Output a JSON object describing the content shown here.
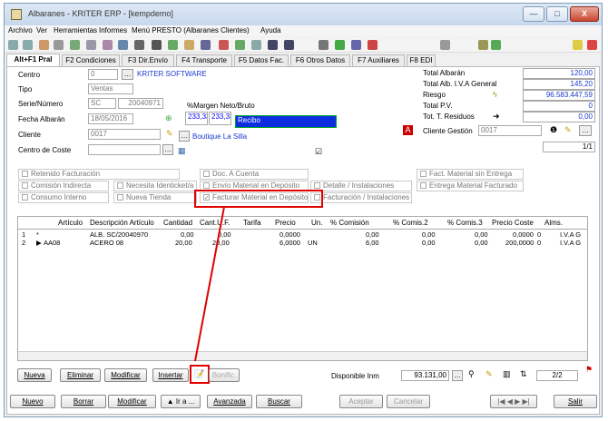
{
  "window": {
    "title": "Albaranes - KRITER ERP - [kempdemo]",
    "min": "—",
    "max": "□",
    "close": "X"
  },
  "menu": [
    "Archivo",
    "Ver",
    "Herramientas",
    "Informes",
    "Menú PRESTO (Albaranes Clientes)",
    "Ayuda"
  ],
  "tabs": [
    "Alt+F1 Pral",
    "F2 Condiciones",
    "F3 Dir.Envío",
    "F4 Transporte",
    "F5 Datos Fac.",
    "F6 Otros Datos",
    "F7 Auxiliares",
    "F8 EDI"
  ],
  "form": {
    "centro_label": "Centro",
    "centro_value": "0",
    "centro_name": "KRITER SOFTWARE",
    "tipo_label": "Tipo",
    "tipo_value": "Ventas",
    "serie_label": "Serie/Número",
    "serie_value": "SC",
    "numero_value": "20040971",
    "fecha_label": "Fecha Albarán",
    "fecha_value": "18/05/2016",
    "cliente_label": "Cliente",
    "cliente_value": "0017",
    "cliente_name": "Boutique La Silla",
    "centro_coste_label": "Centro de Coste",
    "margen_label": "%Margen Neto/Bruto",
    "margen_neto": "233,33",
    "margen_bruto": "233,33",
    "recibo": "Recibo"
  },
  "totals": {
    "total_albaran_label": "Total Albarán",
    "total_albaran": "120,00",
    "total_iva_label": "Total Alb. I.V.A General",
    "total_iva": "145,20",
    "riesgo_label": "Riesgo",
    "riesgo": "96.583.447,59",
    "total_pv_label": "Total P.V.",
    "total_pv": "0",
    "residuos_label": "Tot. T. Residuos",
    "residuos": "0,00",
    "cliente_gestion_label": "Cliente Gestión",
    "cliente_gestion": "0017",
    "page": "1/1"
  },
  "checks": {
    "retenido": "Retenido Facturación",
    "doc_cuenta": "Doc. A Cuenta",
    "fact_sin_entrega": "Fact. Material sin Entrega",
    "comision_indirecta": "Comisión Indirecta",
    "necesita_ident": "Necesita Identicket/a",
    "envio_deposito": "Envío Material en Depósito",
    "detalle_instal": "Detalle / Instalaciones",
    "entrega_facturado": "Entrega Material Facturado",
    "consumo_interno": "Consumo Interno",
    "nueva_tienda": "Nueva Tienda",
    "facturar_deposito": "Facturar Material en Depósito",
    "facturacion_instal": "Facturación / Instalaciones"
  },
  "grid": {
    "headers": [
      "Artículo",
      "Descripción Artículo",
      "Cantidad",
      "Cant.U.F.",
      "Tarifa",
      "Precio",
      "Un.",
      "% Comisión",
      "% Comis.2",
      "% Comis.3",
      "Precio Coste",
      "Alms."
    ],
    "rows": [
      {
        "n": "1",
        "mark": "*",
        "articulo": "",
        "desc": "ALB. SC/20040970",
        "cantidad": "0,00",
        "cantuf": "0,00",
        "tarifa": "",
        "precio": "0,0000",
        "un": "",
        "com": "0,00",
        "com2": "0,00",
        "com3": "0,00",
        "coste": "0,0000",
        "alms": "0",
        "iva": "I.V.A G"
      },
      {
        "n": "2",
        "mark": "▶",
        "articulo": "AA08",
        "desc": "ACERO 08",
        "cantidad": "20,00",
        "cantuf": "20,00",
        "tarifa": "",
        "precio": "6,0000",
        "un": "UN",
        "com": "6,00",
        "com2": "0,00",
        "com3": "0,00",
        "coste": "200,0000",
        "alms": "0",
        "iva": "I.V.A G"
      }
    ]
  },
  "line_buttons": {
    "nueva": "Nueva",
    "eliminar": "Eliminar",
    "modificar": "Modificar",
    "insertar": "Insertar",
    "bonific": "Bonific.",
    "disponible_label": "Disponible Inm",
    "disponible_value": "93.131,00",
    "page": "2/2"
  },
  "bottom_buttons": {
    "nuevo": "Nuevo",
    "borrar": "Borrar",
    "modificar": "Modificar",
    "ira": "▲ Ir a ...",
    "avanzada": "Avanzada",
    "buscar": "Buscar",
    "aceptar": "Aceptar",
    "cancelar": "Cancelar",
    "salir": "Salir",
    "nav": "|◀ ◀ ▶ ▶|"
  }
}
